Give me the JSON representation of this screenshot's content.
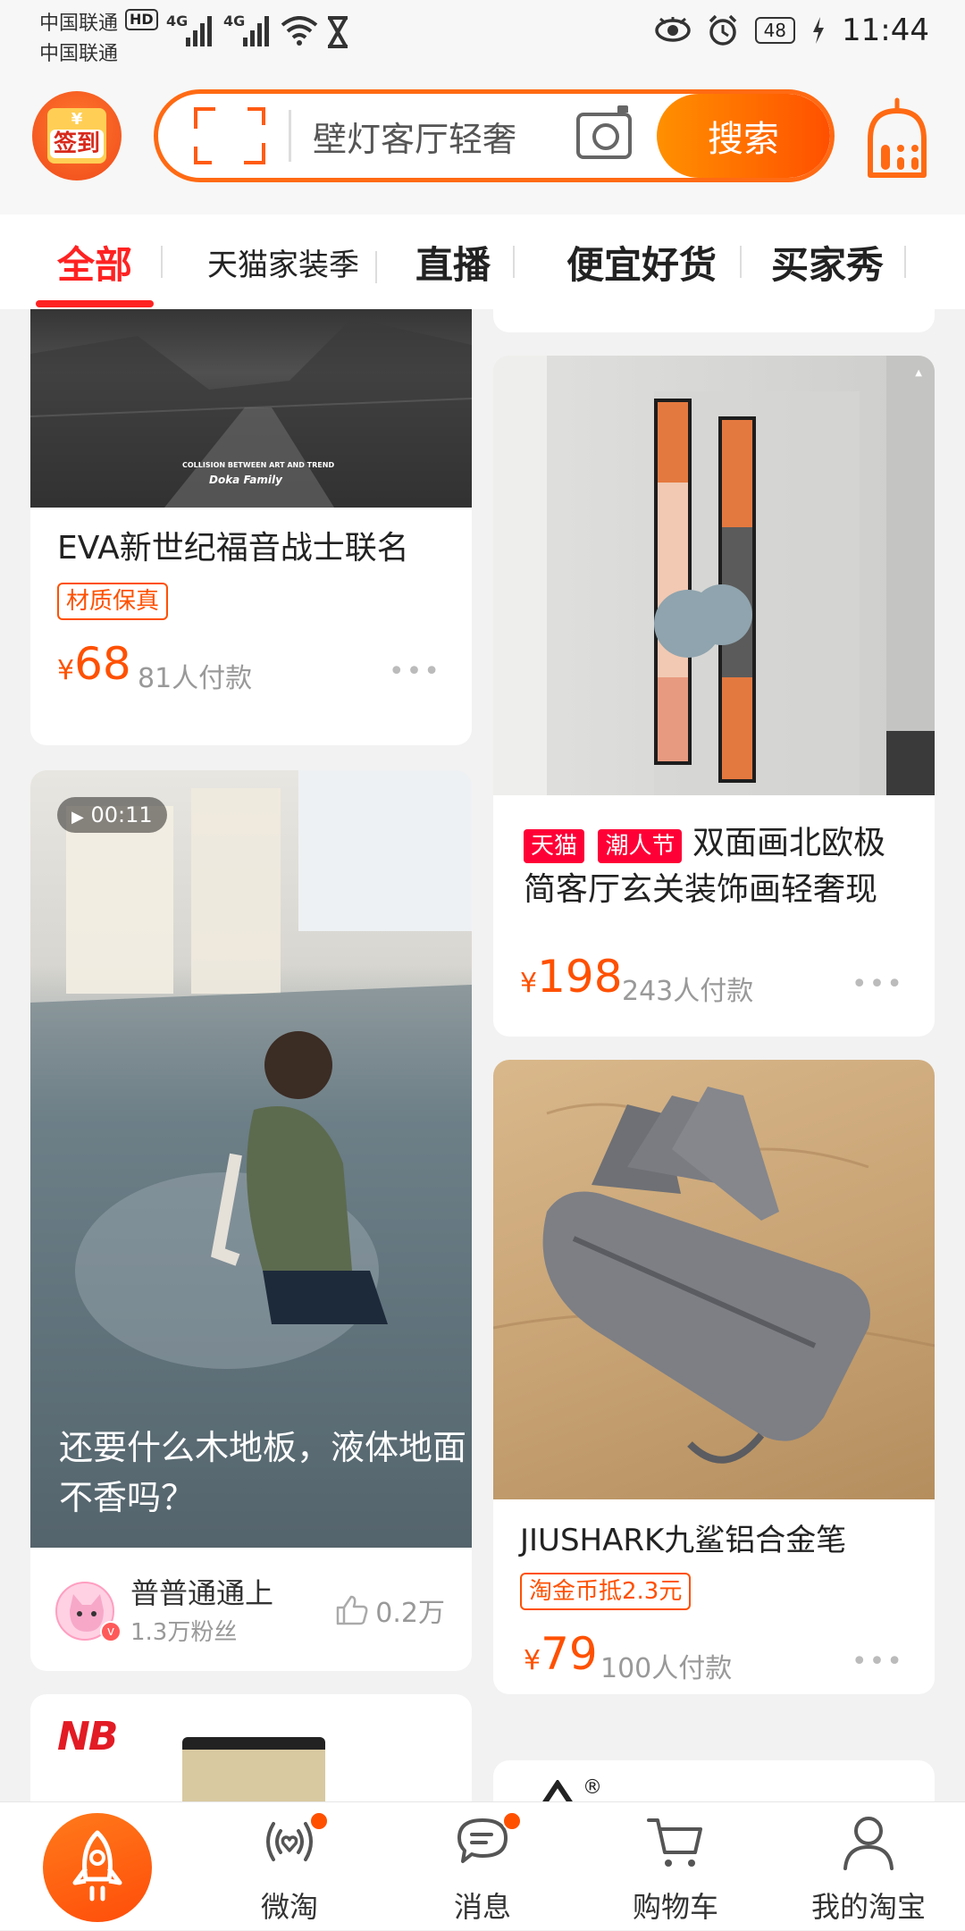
{
  "status": {
    "carrier_line1": "中国联通",
    "carrier_line2": "中国联通",
    "hd": "HD",
    "network1": "4G",
    "network2": "4G",
    "battery": "48",
    "time": "11:44"
  },
  "header": {
    "signin_label": "签到",
    "search_placeholder": "壁灯客厅轻奢",
    "search_button": "搜索"
  },
  "tabs": [
    {
      "label": "全部"
    },
    {
      "label": "天猫家装季"
    },
    {
      "label": "直播"
    },
    {
      "label": "便宜好货"
    },
    {
      "label": "买家秀"
    }
  ],
  "feed": {
    "card_eva": {
      "image_text_1": "COLLISION BETWEEN ART AND TREND",
      "image_text_2": "Doka Family",
      "title": "EVA新世纪福音战士联名",
      "badge": "材质保真",
      "price_symbol": "¥",
      "price": "68",
      "paid": "81人付款"
    },
    "card_video": {
      "duration": "00:11",
      "title": "还要什么木地板，液体地面不香吗？",
      "author": "普普通通上",
      "fans": "1.3万粉丝",
      "likes": "0.2万"
    },
    "card_painting": {
      "badge_tmall": "天猫",
      "badge_event": "潮人节",
      "title_line1": "双面画北欧极",
      "title_line2": "简客厅玄关装饰画轻奢现",
      "price_symbol": "¥",
      "price": "198",
      "paid": "243人付款"
    },
    "card_stand": {
      "title": "JIUSHARK九鲨铝合金笔",
      "badge": "淘金币抵2.3元",
      "price_symbol": "¥",
      "price": "79",
      "paid": "100人付款"
    },
    "card_nb": {
      "brand": "NB"
    },
    "card_partial": {
      "brand_mark": "®"
    }
  },
  "bottom_nav": [
    {
      "label": ""
    },
    {
      "label": "微淘"
    },
    {
      "label": "消息"
    },
    {
      "label": "购物车"
    },
    {
      "label": "我的淘宝"
    }
  ],
  "colors": {
    "accent": "#ff5000",
    "tab_active": "#ff2222",
    "tmall": "#ff0036"
  }
}
